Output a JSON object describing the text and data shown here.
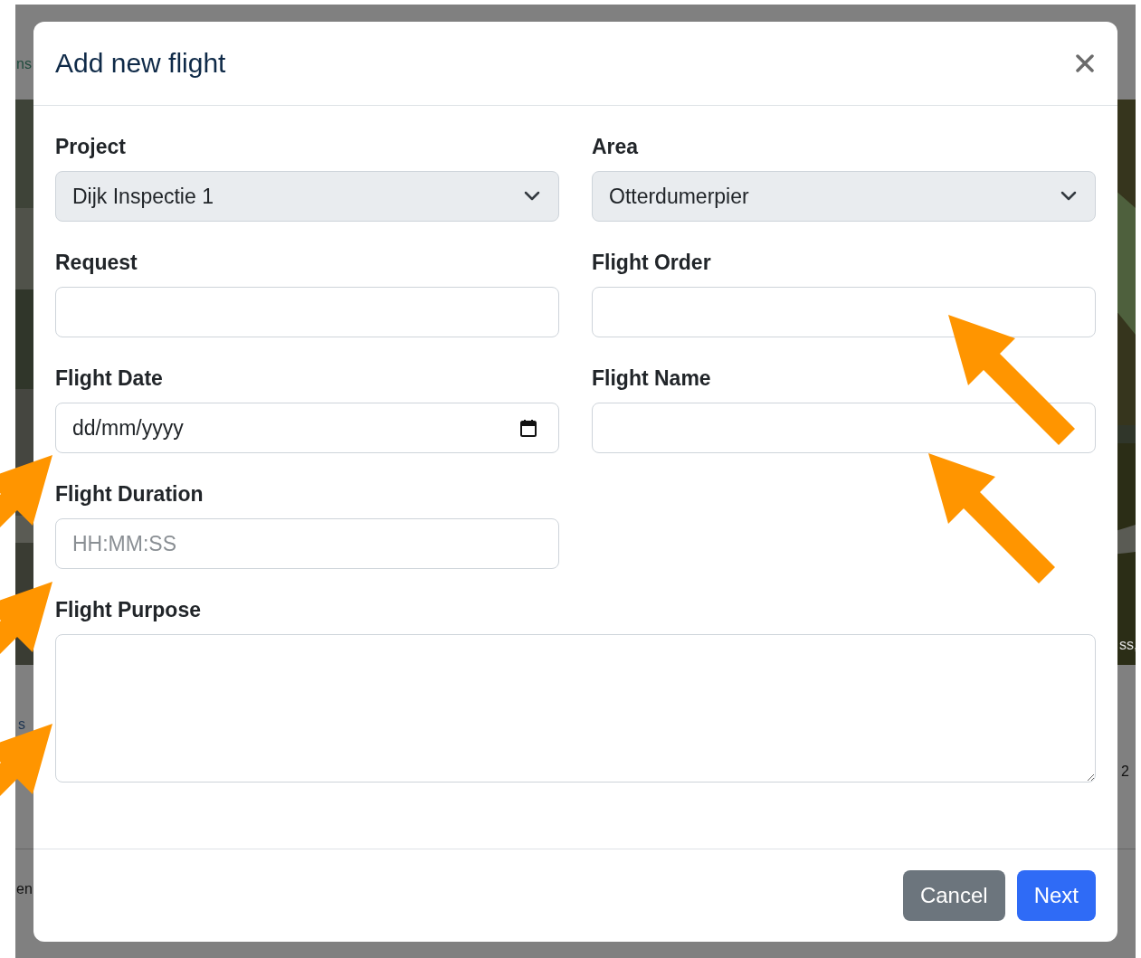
{
  "background": {
    "fragments": [
      "ns",
      "s",
      "en",
      "ss,",
      "2"
    ]
  },
  "dialog": {
    "title": "Add new flight",
    "fields": [
      {
        "kind": "select",
        "label": "Project",
        "value": "Dijk Inspectie 1"
      },
      {
        "kind": "select",
        "label": "Area",
        "value": "Otterdumerpier"
      },
      {
        "kind": "text",
        "label": "Request"
      },
      {
        "kind": "text",
        "label": "Flight Order"
      },
      {
        "kind": "date",
        "label": "Flight Date",
        "value": "dd/mm/yyyy"
      },
      {
        "kind": "text",
        "label": "Flight Name"
      },
      {
        "kind": "text",
        "label": "Flight Duration",
        "placeholder": "HH:MM:SS"
      },
      {
        "kind": "textarea",
        "label": "Flight Purpose"
      }
    ],
    "buttons": [
      {
        "label": "Cancel",
        "kind": "secondary"
      },
      {
        "label": "Next",
        "kind": "primary"
      }
    ]
  }
}
